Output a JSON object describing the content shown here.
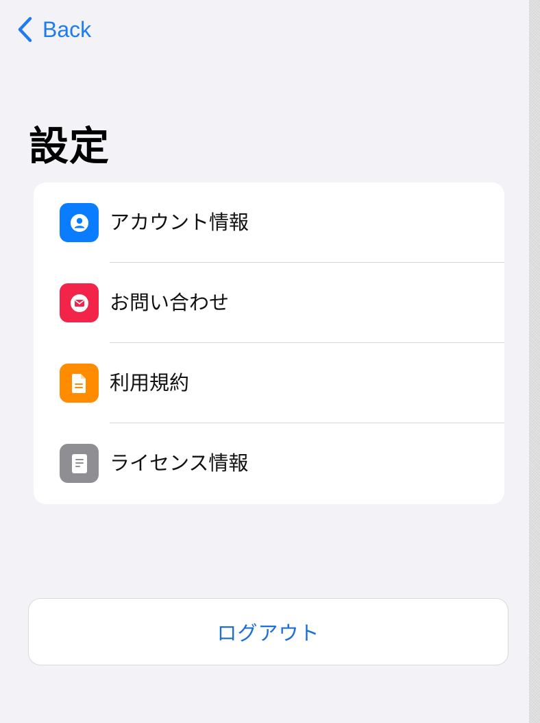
{
  "nav": {
    "back_label": "Back",
    "back_icon": "chevron-left-icon"
  },
  "page": {
    "title": "設定"
  },
  "settings": {
    "items": [
      {
        "label": "アカウント情報",
        "icon": "person-icon",
        "icon_color": "#0a7cff"
      },
      {
        "label": "お問い合わせ",
        "icon": "envelope-icon",
        "icon_color": "#f22449"
      },
      {
        "label": "利用規約",
        "icon": "document-icon",
        "icon_color": "#ff8c00"
      },
      {
        "label": "ライセンス情報",
        "icon": "note-icon",
        "icon_color": "#8e8e93"
      }
    ]
  },
  "actions": {
    "logout_label": "ログアウト"
  },
  "colors": {
    "accent": "#1d7cf2",
    "background": "#f2f2f7",
    "card": "#ffffff"
  }
}
